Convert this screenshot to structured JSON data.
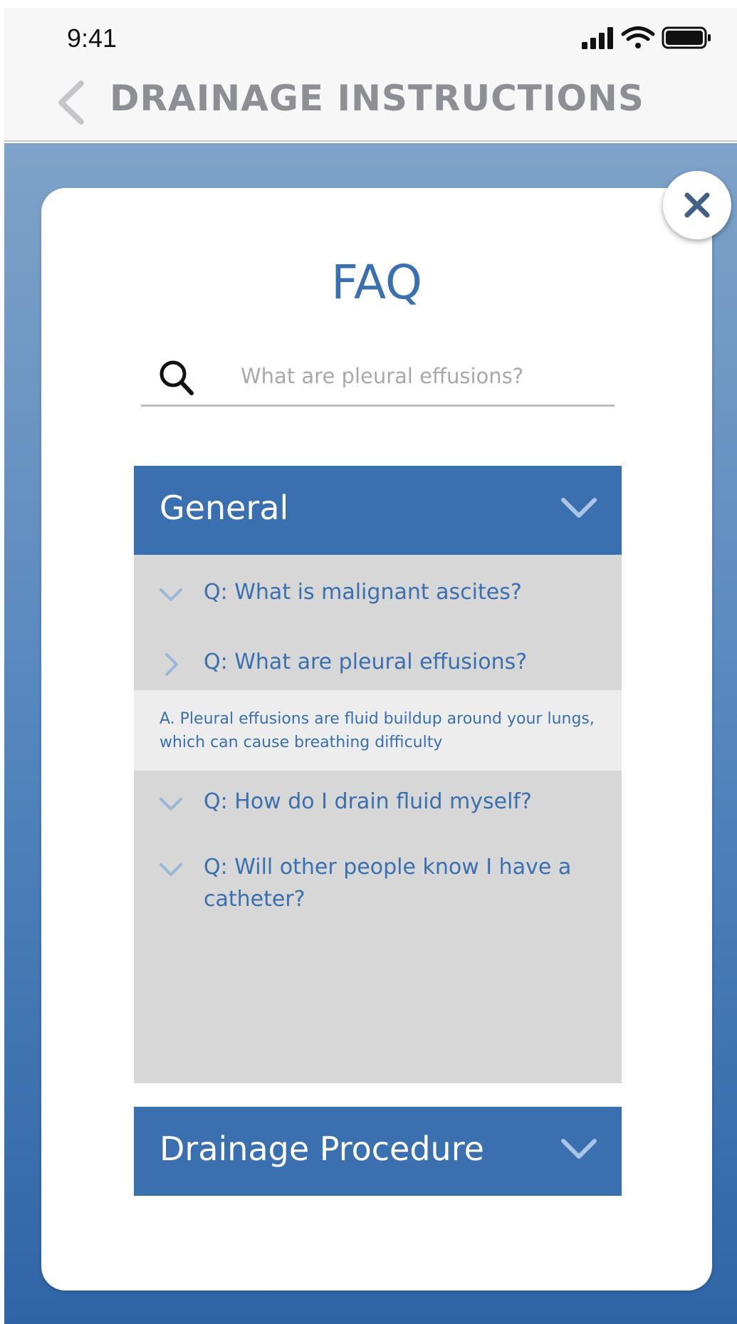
{
  "status_bar": {
    "time": "9:41",
    "icons": [
      "signal-icon",
      "wifi-icon",
      "battery-icon"
    ]
  },
  "header": {
    "back_icon": "chevron-left-icon",
    "title": "DRAINAGE INSTRUCTIONS"
  },
  "modal": {
    "close_icon": "close-icon",
    "title": "FAQ",
    "search": {
      "icon": "search-icon",
      "value": "",
      "placeholder": "What are pleural effusions?"
    },
    "sections": [
      {
        "label": "General",
        "expanded": true,
        "items": [
          {
            "question": "Q: What is malignant ascites?",
            "icon": "chevron-down-icon",
            "expanded": false
          },
          {
            "question": "Q: What are pleural effusions?",
            "icon": "chevron-right-icon",
            "expanded": true,
            "answer": "A. Pleural effusions are fluid buildup around your lungs, which can cause breathing difficulty"
          },
          {
            "question": "Q: How do I drain fluid myself?",
            "icon": "chevron-down-icon",
            "expanded": false
          },
          {
            "question": "Q: Will other people know I have a catheter?",
            "icon": "chevron-down-icon",
            "expanded": false
          }
        ]
      },
      {
        "label": "Drainage Procedure",
        "expanded": false,
        "items": []
      }
    ]
  },
  "colors": {
    "accent": "#3a6fb0",
    "header_text": "#8d8f94",
    "panel_bg": "#d7d7d7",
    "answer_bg": "#ededed",
    "gradient_top": "#7fa3c9",
    "gradient_bottom": "#2f65a7"
  }
}
